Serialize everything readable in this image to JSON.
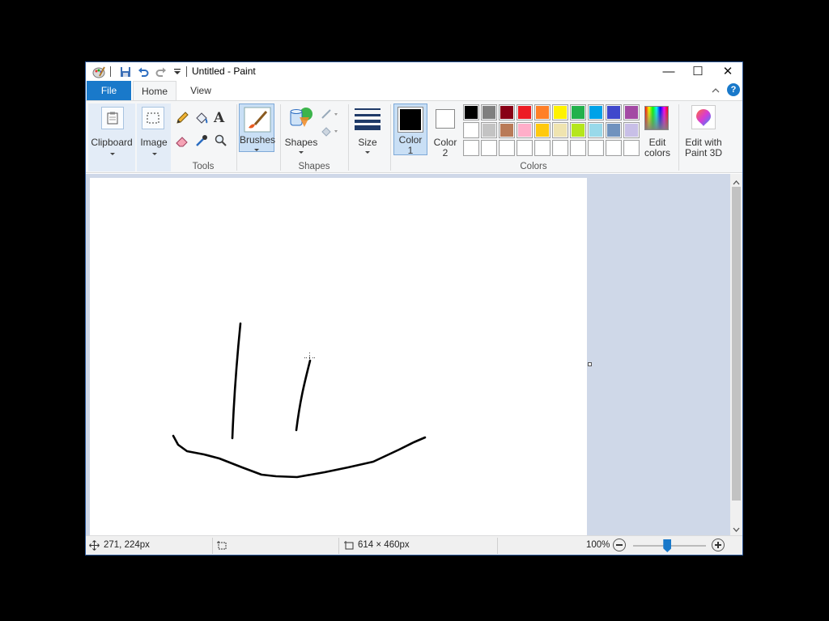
{
  "window": {
    "title": "Untitled - Paint",
    "controls": {
      "minimize": "—",
      "maximize": "☐",
      "close": "✕"
    }
  },
  "tabs": {
    "file": "File",
    "home": "Home",
    "view": "View"
  },
  "ribbon": {
    "clipboard_label": "Clipboard",
    "image_label": "Image",
    "tools_group": "Tools",
    "brushes_label": "Brushes",
    "shapes_label": "Shapes",
    "shapes_group": "Shapes",
    "size_label": "Size",
    "color1_line1": "Color",
    "color1_line2": "1",
    "color2_line1": "Color",
    "color2_line2": "2",
    "colors_group": "Colors",
    "edit_colors_line1": "Edit",
    "edit_colors_line2": "colors",
    "paint3d_line1": "Edit with",
    "paint3d_line2": "Paint 3D"
  },
  "colors": {
    "color1": "#000000",
    "color2": "#ffffff",
    "palette_row1": [
      "#000000",
      "#7f7f7f",
      "#880015",
      "#ed1c24",
      "#ff7f27",
      "#fff200",
      "#22b14c",
      "#00a2e8",
      "#3f48cc",
      "#a349a4"
    ],
    "palette_row2": [
      "#ffffff",
      "#c3c3c3",
      "#b97a57",
      "#ffaec9",
      "#ffc90e",
      "#efe4b0",
      "#b5e61d",
      "#99d9ea",
      "#7092be",
      "#c8bfe7"
    ],
    "palette_row3": [
      "#ffffff",
      "#ffffff",
      "#ffffff",
      "#ffffff",
      "#ffffff",
      "#ffffff",
      "#ffffff",
      "#ffffff",
      "#ffffff",
      "#ffffff"
    ],
    "accent": "#1979ca"
  },
  "status": {
    "cursor_pos": "271, 224px",
    "image_size": "614 × 460px",
    "zoom": "100%",
    "zoom_level": 1.0
  }
}
